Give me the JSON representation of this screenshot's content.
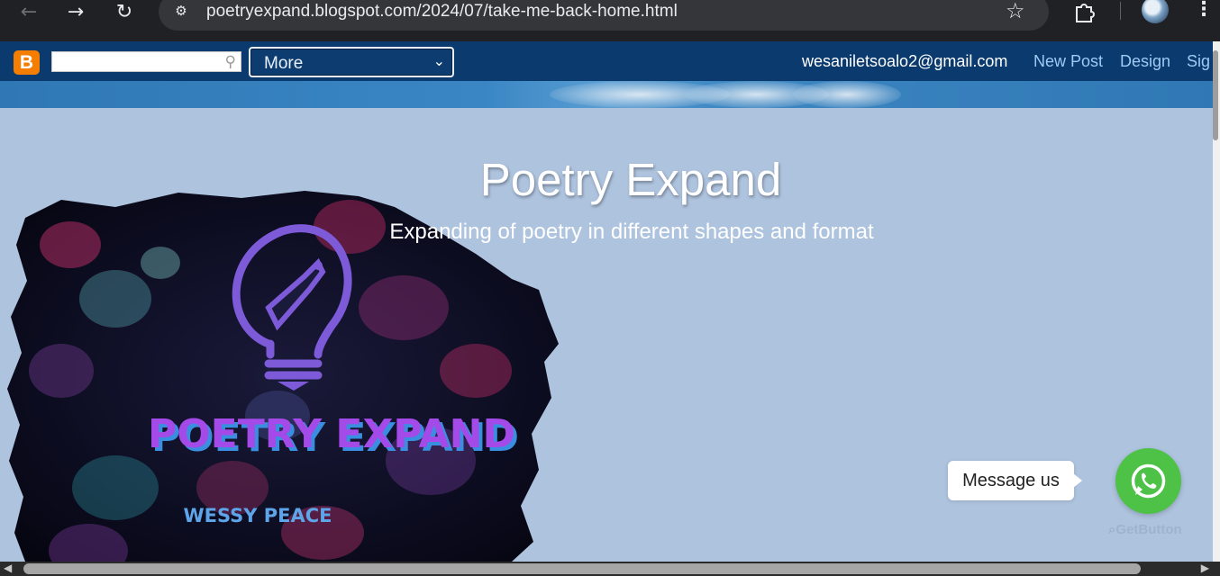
{
  "browser": {
    "back_icon": "arrow-left-icon",
    "forward_icon": "arrow-right-icon",
    "reload_icon": "reload-icon",
    "url": "poetryexpand.blogspot.com/2024/07/take-me-back-home.html",
    "bookmark_icon": "star-icon",
    "extensions_icon": "puzzle-icon",
    "menu_icon": "kebab-icon"
  },
  "navbar": {
    "logo": "B",
    "search_placeholder": "",
    "more_label": "More",
    "email": "wesaniletsoalo2@gmail.com",
    "links": [
      "New Post",
      "Design",
      "Sig"
    ]
  },
  "blog": {
    "title": "Poetry Expand",
    "description": "Expanding of poetry in different shapes and format",
    "header_image": {
      "title_text": "POETRY EXPAND",
      "author_text": "WESSY PEACE"
    }
  },
  "whatsapp": {
    "message": "Message us",
    "brand": "GetButton"
  },
  "colors": {
    "navbar": "#0b3a6e",
    "page_bg": "#aec3de",
    "whatsapp_green": "#4dc247",
    "link": "#9fcaf5"
  }
}
